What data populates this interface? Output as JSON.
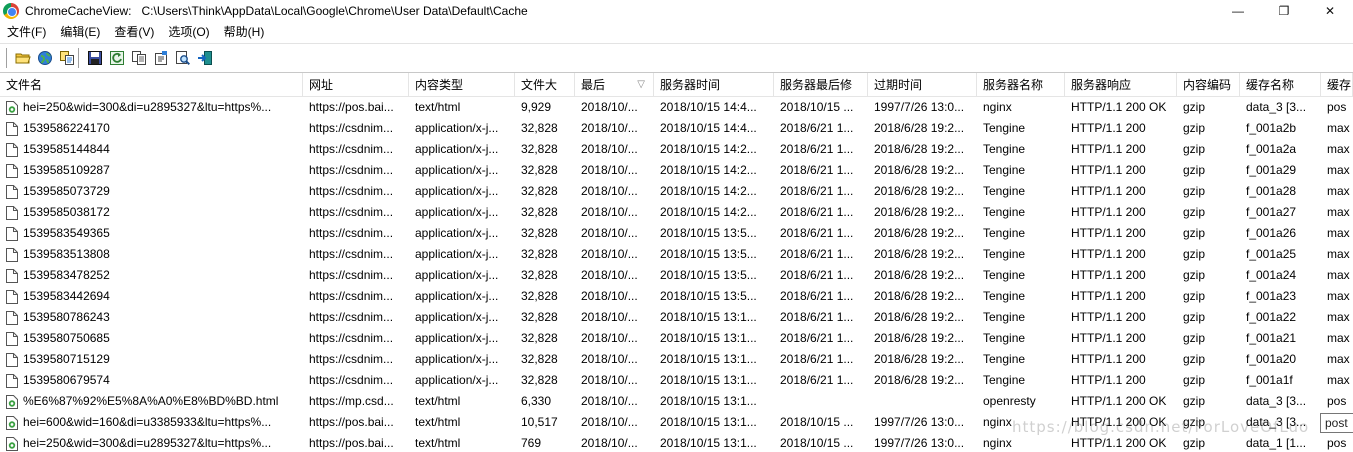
{
  "window": {
    "title": "ChromeCacheView:   C:\\Users\\Think\\AppData\\Local\\Google\\Chrome\\User Data\\Default\\Cache",
    "minimize": "—",
    "restore": "❐",
    "close": "✕"
  },
  "menu": [
    "文件(F)",
    "编辑(E)",
    "查看(V)",
    "选项(O)",
    "帮助(H)"
  ],
  "toolbar": [
    "open-folder-icon",
    "globe-icon",
    "copy-files-icon",
    "save-icon",
    "refresh-icon",
    "copy-icon",
    "properties-icon",
    "find-icon",
    "exit-icon"
  ],
  "columns": [
    "文件名",
    "网址",
    "内容类型",
    "文件大",
    "最后",
    "服务器时间",
    "服务器最后修",
    "过期时间",
    "服务器名称",
    "服务器响应",
    "内容编码",
    "缓存名称",
    "缓存"
  ],
  "sorted_column": "最后",
  "rows": [
    {
      "icon": "html",
      "cells": [
        "hei=250&wid=300&di=u2895327&ltu=https%...",
        "https://pos.bai...",
        "text/html",
        "9,929",
        "2018/10/...",
        "2018/10/15 14:4...",
        "2018/10/15 ...",
        "1997/7/26 13:0...",
        "nginx",
        "HTTP/1.1 200 OK",
        "gzip",
        "data_3  [3...",
        "pos"
      ]
    },
    {
      "icon": "file",
      "cells": [
        "1539586224170",
        "https://csdnim...",
        "application/x-j...",
        "32,828",
        "2018/10/...",
        "2018/10/15 14:4...",
        "2018/6/21 1...",
        "2018/6/28 19:2...",
        "Tengine",
        "HTTP/1.1 200",
        "gzip",
        "f_001a2b",
        "max"
      ]
    },
    {
      "icon": "file",
      "cells": [
        "1539585144844",
        "https://csdnim...",
        "application/x-j...",
        "32,828",
        "2018/10/...",
        "2018/10/15 14:2...",
        "2018/6/21 1...",
        "2018/6/28 19:2...",
        "Tengine",
        "HTTP/1.1 200",
        "gzip",
        "f_001a2a",
        "max"
      ]
    },
    {
      "icon": "file",
      "cells": [
        "1539585109287",
        "https://csdnim...",
        "application/x-j...",
        "32,828",
        "2018/10/...",
        "2018/10/15 14:2...",
        "2018/6/21 1...",
        "2018/6/28 19:2...",
        "Tengine",
        "HTTP/1.1 200",
        "gzip",
        "f_001a29",
        "max"
      ]
    },
    {
      "icon": "file",
      "cells": [
        "1539585073729",
        "https://csdnim...",
        "application/x-j...",
        "32,828",
        "2018/10/...",
        "2018/10/15 14:2...",
        "2018/6/21 1...",
        "2018/6/28 19:2...",
        "Tengine",
        "HTTP/1.1 200",
        "gzip",
        "f_001a28",
        "max"
      ]
    },
    {
      "icon": "file",
      "cells": [
        "1539585038172",
        "https://csdnim...",
        "application/x-j...",
        "32,828",
        "2018/10/...",
        "2018/10/15 14:2...",
        "2018/6/21 1...",
        "2018/6/28 19:2...",
        "Tengine",
        "HTTP/1.1 200",
        "gzip",
        "f_001a27",
        "max"
      ]
    },
    {
      "icon": "file",
      "cells": [
        "1539583549365",
        "https://csdnim...",
        "application/x-j...",
        "32,828",
        "2018/10/...",
        "2018/10/15 13:5...",
        "2018/6/21 1...",
        "2018/6/28 19:2...",
        "Tengine",
        "HTTP/1.1 200",
        "gzip",
        "f_001a26",
        "max"
      ]
    },
    {
      "icon": "file",
      "cells": [
        "1539583513808",
        "https://csdnim...",
        "application/x-j...",
        "32,828",
        "2018/10/...",
        "2018/10/15 13:5...",
        "2018/6/21 1...",
        "2018/6/28 19:2...",
        "Tengine",
        "HTTP/1.1 200",
        "gzip",
        "f_001a25",
        "max"
      ]
    },
    {
      "icon": "file",
      "cells": [
        "1539583478252",
        "https://csdnim...",
        "application/x-j...",
        "32,828",
        "2018/10/...",
        "2018/10/15 13:5...",
        "2018/6/21 1...",
        "2018/6/28 19:2...",
        "Tengine",
        "HTTP/1.1 200",
        "gzip",
        "f_001a24",
        "max"
      ]
    },
    {
      "icon": "file",
      "cells": [
        "1539583442694",
        "https://csdnim...",
        "application/x-j...",
        "32,828",
        "2018/10/...",
        "2018/10/15 13:5...",
        "2018/6/21 1...",
        "2018/6/28 19:2...",
        "Tengine",
        "HTTP/1.1 200",
        "gzip",
        "f_001a23",
        "max"
      ]
    },
    {
      "icon": "file",
      "cells": [
        "1539580786243",
        "https://csdnim...",
        "application/x-j...",
        "32,828",
        "2018/10/...",
        "2018/10/15 13:1...",
        "2018/6/21 1...",
        "2018/6/28 19:2...",
        "Tengine",
        "HTTP/1.1 200",
        "gzip",
        "f_001a22",
        "max"
      ]
    },
    {
      "icon": "file",
      "cells": [
        "1539580750685",
        "https://csdnim...",
        "application/x-j...",
        "32,828",
        "2018/10/...",
        "2018/10/15 13:1...",
        "2018/6/21 1...",
        "2018/6/28 19:2...",
        "Tengine",
        "HTTP/1.1 200",
        "gzip",
        "f_001a21",
        "max"
      ]
    },
    {
      "icon": "file",
      "cells": [
        "1539580715129",
        "https://csdnim...",
        "application/x-j...",
        "32,828",
        "2018/10/...",
        "2018/10/15 13:1...",
        "2018/6/21 1...",
        "2018/6/28 19:2...",
        "Tengine",
        "HTTP/1.1 200",
        "gzip",
        "f_001a20",
        "max"
      ]
    },
    {
      "icon": "file",
      "cells": [
        "1539580679574",
        "https://csdnim...",
        "application/x-j...",
        "32,828",
        "2018/10/...",
        "2018/10/15 13:1...",
        "2018/6/21 1...",
        "2018/6/28 19:2...",
        "Tengine",
        "HTTP/1.1 200",
        "gzip",
        "f_001a1f",
        "max"
      ]
    },
    {
      "icon": "html",
      "cells": [
        "%E6%87%92%E5%8A%A0%E8%BD%BD.html",
        "https://mp.csd...",
        "text/html",
        "6,330",
        "2018/10/...",
        "2018/10/15 13:1...",
        "",
        "",
        "openresty",
        "HTTP/1.1 200 OK",
        "gzip",
        "data_3  [3...",
        "pos"
      ]
    },
    {
      "icon": "html",
      "cells": [
        "hei=600&wid=160&di=u3385933&ltu=https%...",
        "https://pos.bai...",
        "text/html",
        "10,517",
        "2018/10/...",
        "2018/10/15 13:1...",
        "2018/10/15 ...",
        "1997/7/26 13:0...",
        "nginx",
        "HTTP/1.1 200 OK",
        "gzip",
        "data_3  [3...",
        ""
      ]
    },
    {
      "icon": "html",
      "cells": [
        "hei=250&wid=300&di=u2895327&ltu=https%...",
        "https://pos.bai...",
        "text/html",
        "769",
        "2018/10/...",
        "2018/10/15 13:1...",
        "2018/10/15 ...",
        "1997/7/26 13:0...",
        "nginx",
        "HTTP/1.1 200 OK",
        "gzip",
        "data_1  [1...",
        "pos"
      ]
    }
  ],
  "tooltip": "post",
  "watermark": "https://blog.csdn.net/ForLoveOfLuo"
}
